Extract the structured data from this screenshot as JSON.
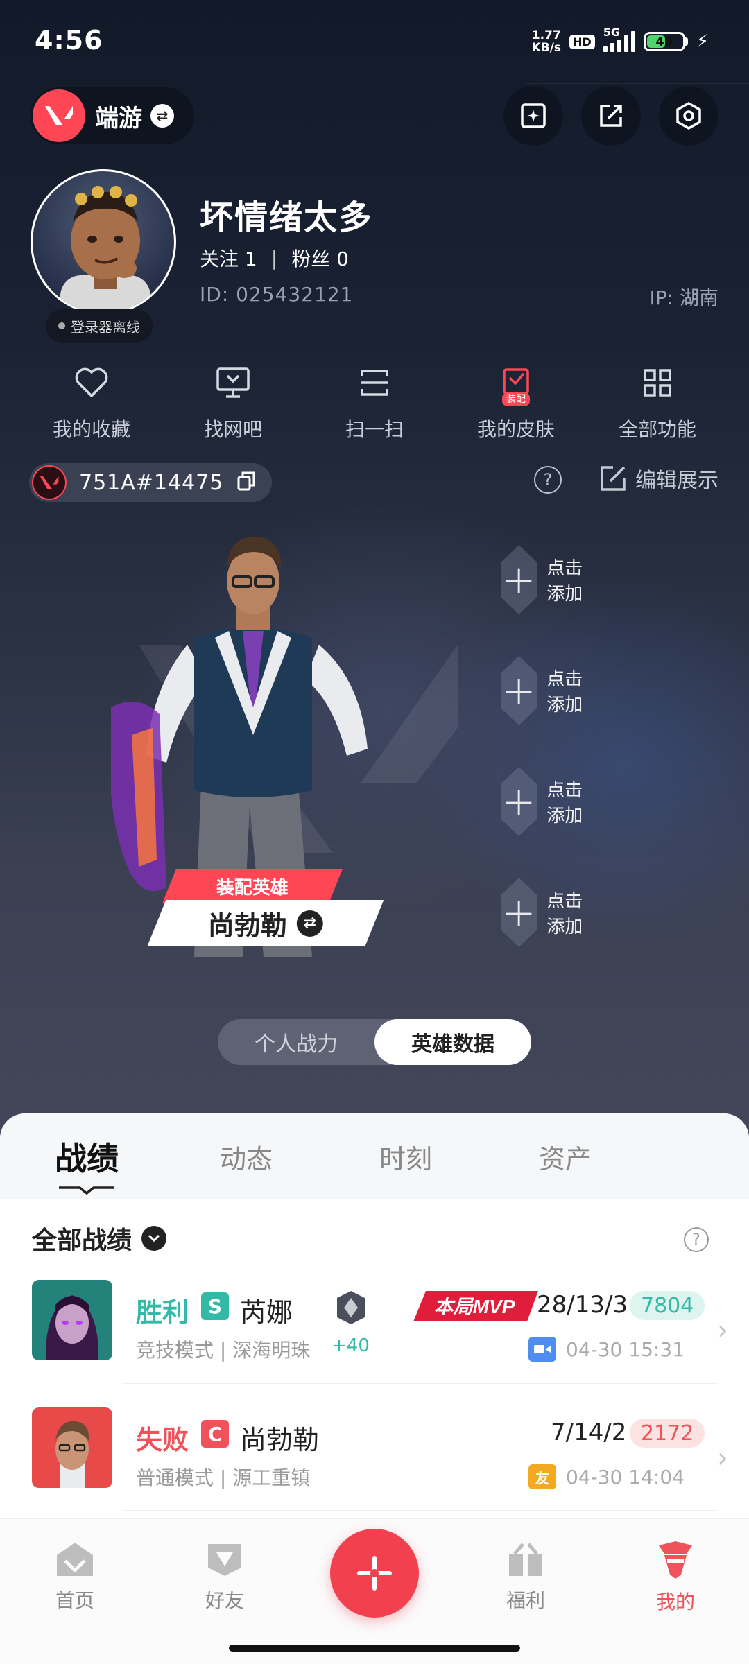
{
  "status_bar": {
    "time": "4:56",
    "net_speed_value": "1.77",
    "net_speed_unit": "KB/s",
    "hd": "HD",
    "network": "5G",
    "battery": "49"
  },
  "header": {
    "game_name": "端游"
  },
  "profile": {
    "nickname": "坏情绪太多",
    "follow_label": "关注",
    "follow_count": "1",
    "separator": "|",
    "fans_label": "粉丝",
    "fans_count": "0",
    "id_text": "ID: 025432121",
    "ip_text": "IP: 湖南",
    "status": "登录器离线"
  },
  "quick_menu": [
    {
      "label": "我的收藏",
      "icon": "heart-icon"
    },
    {
      "label": "找网吧",
      "icon": "monitor-icon"
    },
    {
      "label": "扫一扫",
      "icon": "scan-icon"
    },
    {
      "label": "我的皮肤",
      "icon": "skin-icon",
      "badge": "装配"
    },
    {
      "label": "全部功能",
      "icon": "grid-icon"
    }
  ],
  "riot": {
    "riot_id": "751A#14475",
    "edit_label": "编辑展示",
    "help": "?"
  },
  "agent": {
    "tag": "装配英雄",
    "name": "尚勃勒",
    "slots": [
      "点击添加",
      "点击添加",
      "点击添加",
      "点击添加"
    ]
  },
  "segment": {
    "options": [
      "个人战力",
      "英雄数据"
    ],
    "active_index": 1
  },
  "tabs": [
    "战绩",
    "动态",
    "时刻",
    "资产"
  ],
  "active_tab": 0,
  "records": {
    "filter_label": "全部战绩",
    "help": "?",
    "matches": [
      {
        "result": "胜利",
        "rank_badge": "S",
        "agent": "芮娜",
        "mode": "竞技模式 | 深海明珠",
        "rank_delta": "+40",
        "mvp": "本局MVP",
        "kda": "28/13/3",
        "score": "7804",
        "time": "04-30 15:31",
        "time_icon": "video-icon"
      },
      {
        "result": "失败",
        "rank_badge": "C",
        "agent": "尚勃勒",
        "mode": "普通模式 | 源工重镇",
        "kda": "7/14/2",
        "score": "2172",
        "time": "04-30 14:04",
        "time_icon_text": "友"
      }
    ]
  },
  "bottom_nav": {
    "items": [
      {
        "label": "首页",
        "icon": "home-icon"
      },
      {
        "label": "好友",
        "icon": "friends-icon"
      },
      {
        "label": "福利",
        "icon": "gift-icon"
      },
      {
        "label": "我的",
        "icon": "profile-icon"
      }
    ],
    "active": "我的"
  },
  "colors": {
    "accent": "#ff4655",
    "win": "#33b9a8",
    "lose": "#f0525b"
  }
}
